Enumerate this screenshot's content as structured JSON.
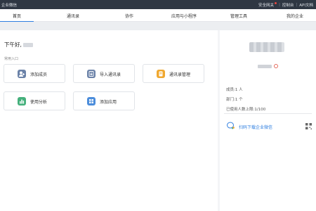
{
  "topbar": {
    "app_title": "企业微信",
    "links": [
      "安全网关",
      "控制台",
      "API文档"
    ]
  },
  "nav": {
    "tabs": [
      "首页",
      "通讯录",
      "协作",
      "应用与小程序",
      "管理工具",
      "我的企业"
    ],
    "active_index": 0
  },
  "main": {
    "greeting": "下午好,",
    "section_label": "常用入口",
    "cards": [
      {
        "label": "添加成员",
        "icon": "add-member-icon",
        "color": "#6b82a8"
      },
      {
        "label": "导入通讯录",
        "icon": "import-contacts-icon",
        "color": "#6b82a8"
      },
      {
        "label": "通讯录管理",
        "icon": "contacts-manage-icon",
        "color": "#f0a830"
      },
      {
        "label": "使用分析",
        "icon": "bar-chart-icon",
        "color": "#45b07c"
      },
      {
        "label": "添加应用",
        "icon": "apps-grid-icon",
        "color": "#4c8ddb"
      }
    ]
  },
  "side": {
    "members": "成员:1 人",
    "departments": "部门:1 个",
    "usage": "已使用人数上限:1/100",
    "download_text": "扫码下载企业微信"
  },
  "colors": {
    "accent": "#2f7fe0",
    "topbar": "#2f3743"
  }
}
